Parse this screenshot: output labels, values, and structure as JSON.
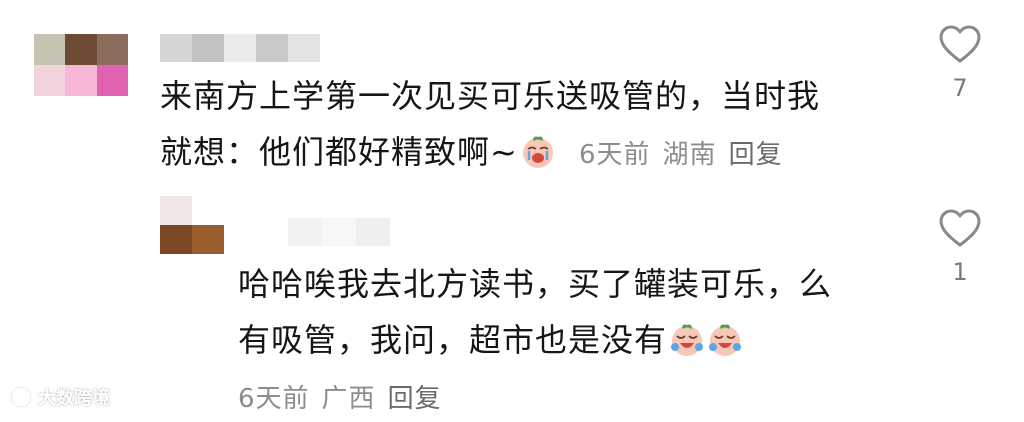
{
  "comment": {
    "text_line1": "来南方上学第一次见买可乐送吸管的，当时我",
    "text_line2": "就想：他们都好精致啊~",
    "time": "6天前",
    "location": "湖南",
    "reply_label": "回复",
    "likes": "7",
    "emoji_icon": "crying-face-emoji",
    "avatar_colors": [
      "#c7c3b3",
      "#6f4a35",
      "#8a6d5c",
      "#f2d4dc",
      "#f6b7d6",
      "#e062b0"
    ]
  },
  "reply": {
    "text_line1": "哈哈唉我去北方读书，买了罐装可乐，么",
    "text_line2": "有吸管，我问，超市也是没有",
    "time": "6天前",
    "location": "广西",
    "reply_label": "回复",
    "likes": "1",
    "emoji_icon": "laugh-cry-emoji",
    "avatar_colors": [
      "#f1e8e6",
      "#ffffff",
      "#7b4a25",
      "#9a5d2c"
    ]
  },
  "watermark": {
    "text": "大数跨境",
    "icon": "watermark-logo-icon"
  },
  "colors": {
    "text": "#161616",
    "meta": "#8d8d8d",
    "icon": "#8a8a8a"
  }
}
